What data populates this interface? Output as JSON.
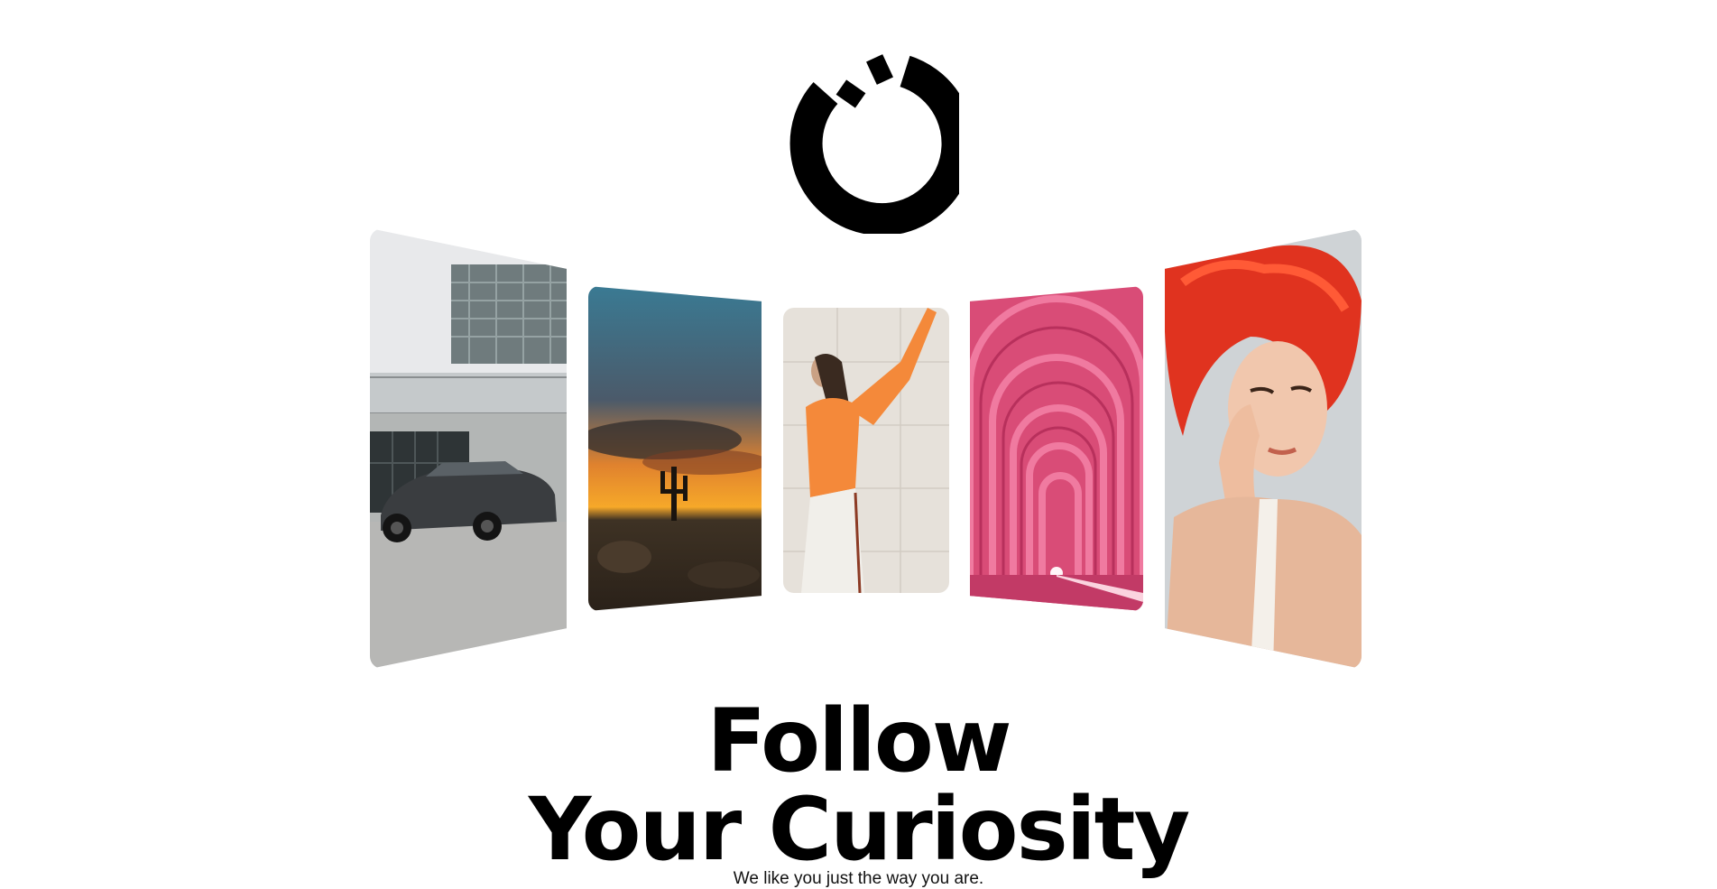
{
  "logo": {
    "icon": "loading-ring-logo",
    "color": "#000000"
  },
  "cards": [
    {
      "name": "car-photo",
      "description_icon": "gray-car-parking-image"
    },
    {
      "name": "desert-sunset-photo",
      "description_icon": "desert-sunset-image"
    },
    {
      "name": "dancer-orange-top-photo",
      "description_icon": "woman-orange-top-image"
    },
    {
      "name": "pink-arches-tunnel-photo",
      "description_icon": "pink-arches-image"
    },
    {
      "name": "red-hair-portrait-photo",
      "description_icon": "red-hair-portrait-image"
    }
  ],
  "hero": {
    "title_line1": "Follow",
    "title_line2": "Your Curiosity",
    "tagline": "We like you just the way you are."
  },
  "colors": {
    "background": "#ffffff",
    "text": "#000000"
  }
}
